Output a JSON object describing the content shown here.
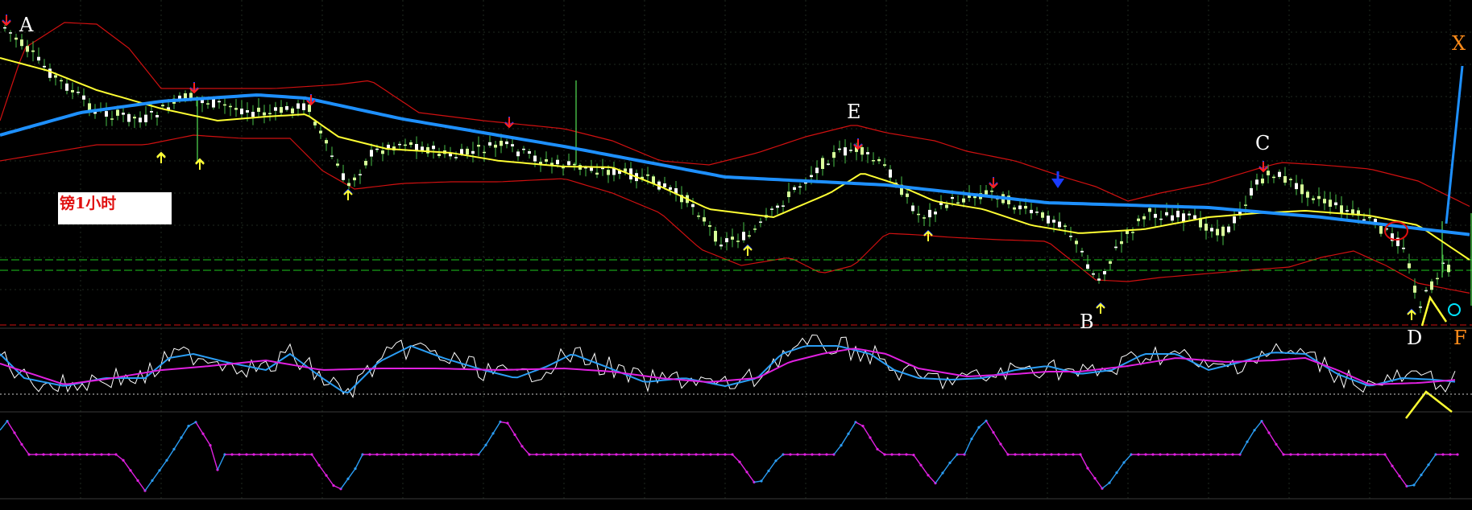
{
  "caption": "镑1小时",
  "point_labels": [
    "A",
    "B",
    "C",
    "D",
    "E",
    "F",
    "X"
  ],
  "colors": {
    "background": "#000000",
    "grid": "#1f2a1f",
    "bull_candle": "#d8ff9a",
    "bear_candle": "#ffffff",
    "wick": "#48c048",
    "slow_ma": "#1e90ff",
    "fast_ma": "#ffff33",
    "bands": "#d01010",
    "support_line": "#1ec81e",
    "lower_line": "#d01010",
    "signal_up": "#ffff33",
    "signal_down": "#ff2020",
    "signal_alt": "#1a3cff",
    "osc_white": "#ffffff",
    "osc_blue": "#2a9df4",
    "osc_magenta": "#e020e0",
    "step_blue": "#2a9df4",
    "step_magenta": "#e020e0",
    "markers_circle_red": "#e01010",
    "markers_circle_cyan": "#00e5ff",
    "marker_annotation": "#ffff33"
  },
  "chart_data": [
    {
      "type": "candlestick",
      "title": "",
      "panel": "price",
      "indicators": [
        "slow moving average (blue)",
        "fast moving average (yellow)",
        "envelope bands (red)"
      ],
      "horizontal_lines": [
        "green dashed upper",
        "green dashed lower",
        "red dashed bottom"
      ],
      "annotations": [
        "A",
        "B",
        "C",
        "D",
        "E",
        "F",
        "X"
      ],
      "markers": [
        "red circle near right",
        "cyan circle at last candle",
        "yellow V under D"
      ],
      "grid": true
    },
    {
      "type": "line",
      "panel": "oscillator",
      "series_colors": [
        "white",
        "blue",
        "magenta"
      ],
      "reference_line": "white dotted"
    },
    {
      "type": "line",
      "panel": "step indicator",
      "series_colors": [
        "blue",
        "magenta"
      ]
    }
  ]
}
